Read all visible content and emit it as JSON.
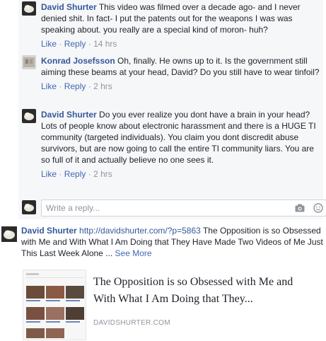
{
  "comments": [
    {
      "author": "David Shurter",
      "text": "This video was filmed over a decade ago- and I never denied shit. In fact- I put the patents out for the weapons I was was speaking about. you really are a special kind of moron- huh?",
      "like": "Like",
      "sep": "·",
      "reply": "Reply",
      "time": "14 hrs"
    },
    {
      "author": "Konrad Josefsson",
      "text": "Oh, finally. He owns up to it. Is the government still aiming these beams at your head, David? Do you still have to wear tinfoil?",
      "like": "Like",
      "sep": "·",
      "reply": "Reply",
      "time": "2 hrs"
    },
    {
      "author": "David Shurter",
      "text": "Do you ever realize you dont have a brain in your head? Lots of people know about electronic harassment and there is a HUGE TI community (targeted individuals). You claim you dont discredit abuse survivors, but are now going to call the entire TI community liars. You are so full of it and actually believe no one sees it.",
      "like": "Like",
      "sep": "·",
      "reply": "Reply",
      "time": "2 hrs"
    }
  ],
  "composer": {
    "placeholder": "Write a reply...",
    "camera_icon": "camera-icon",
    "emoji_icon": "emoji-icon"
  },
  "post": {
    "author": "David Shurter",
    "url": "http://davidshurter.com/?p=5863",
    "text": "The Opposition is so Obsessed with Me and With What I Am Doing that They Have Made Two Videos of Me Just This Last Week Alone ...",
    "see_more": "See More"
  },
  "link_card": {
    "title": "The Opposition is so Obsessed with Me and With What I Am Doing that They...",
    "domain": "DAVIDSHURTER.COM"
  },
  "colors": {
    "link": "#365899",
    "action": "#4267b2",
    "muted": "#90949c",
    "thread_bg": "#f6f7f9"
  }
}
